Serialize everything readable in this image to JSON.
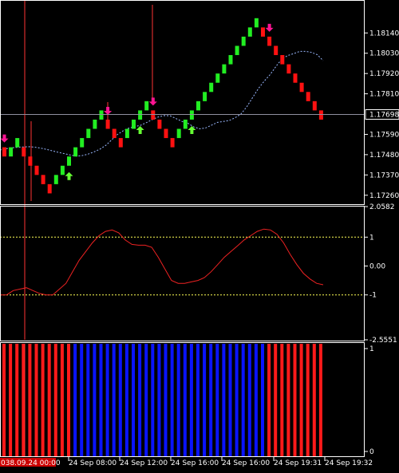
{
  "colors": {
    "background": "#000000",
    "bull_candle": "#22ee22",
    "bear_candle": "#ff1111",
    "ma_line": "#9ab8ff",
    "osc_line": "#ee2222",
    "level_line": "#ffff55",
    "hist_bear": "#ff1a1a",
    "hist_bull": "#0a14ff",
    "buy_arrow": "#66ff33",
    "sell_arrow": "#ff1493",
    "frame": "#ffffff",
    "marker_line": "#ff3333",
    "price_line": "#9090a0"
  },
  "chart_data": [
    {
      "type": "candlestick",
      "title": "",
      "ylim": [
        1.1722,
        1.1831
      ],
      "y_ticks": [
        "1.18140",
        "1.18030",
        "1.17920",
        "1.17810",
        "1.17590",
        "1.17480",
        "1.17370",
        "1.17260"
      ],
      "current_price": "1.17698",
      "bricks": [
        {
          "d": "bear",
          "lo": 1.1747,
          "hi": 1.1752
        },
        {
          "d": "bull",
          "lo": 1.1747,
          "hi": 1.1752
        },
        {
          "d": "bull",
          "lo": 1.1752,
          "hi": 1.1757
        },
        {
          "d": "bear",
          "lo": 1.1747,
          "hi": 1.1752
        },
        {
          "d": "bear",
          "lo": 1.1742,
          "hi": 1.1747
        },
        {
          "d": "bear",
          "lo": 1.1737,
          "hi": 1.1742
        },
        {
          "d": "bear",
          "lo": 1.1732,
          "hi": 1.1737
        },
        {
          "d": "bear",
          "lo": 1.1727,
          "hi": 1.1732
        },
        {
          "d": "bull",
          "lo": 1.1732,
          "hi": 1.1737
        },
        {
          "d": "bull",
          "lo": 1.1737,
          "hi": 1.1742
        },
        {
          "d": "bull",
          "lo": 1.1742,
          "hi": 1.1747
        },
        {
          "d": "bull",
          "lo": 1.1747,
          "hi": 1.1752
        },
        {
          "d": "bull",
          "lo": 1.1752,
          "hi": 1.1757
        },
        {
          "d": "bull",
          "lo": 1.1757,
          "hi": 1.1762
        },
        {
          "d": "bull",
          "lo": 1.1762,
          "hi": 1.1767
        },
        {
          "d": "bull",
          "lo": 1.1767,
          "hi": 1.1772
        },
        {
          "d": "bear",
          "lo": 1.1762,
          "hi": 1.1767
        },
        {
          "d": "bear",
          "lo": 1.1757,
          "hi": 1.1762
        },
        {
          "d": "bear",
          "lo": 1.1752,
          "hi": 1.1757
        },
        {
          "d": "bull",
          "lo": 1.1757,
          "hi": 1.1762
        },
        {
          "d": "bull",
          "lo": 1.1762,
          "hi": 1.1767
        },
        {
          "d": "bull",
          "lo": 1.1767,
          "hi": 1.1772
        },
        {
          "d": "bull",
          "lo": 1.1772,
          "hi": 1.1777
        },
        {
          "d": "bear",
          "lo": 1.1767,
          "hi": 1.1772
        },
        {
          "d": "bear",
          "lo": 1.1762,
          "hi": 1.1767
        },
        {
          "d": "bear",
          "lo": 1.1757,
          "hi": 1.1762
        },
        {
          "d": "bear",
          "lo": 1.1752,
          "hi": 1.1757
        },
        {
          "d": "bull",
          "lo": 1.1757,
          "hi": 1.1762
        },
        {
          "d": "bull",
          "lo": 1.1762,
          "hi": 1.1767
        },
        {
          "d": "bull",
          "lo": 1.1767,
          "hi": 1.1772
        },
        {
          "d": "bull",
          "lo": 1.1772,
          "hi": 1.1777
        },
        {
          "d": "bull",
          "lo": 1.1777,
          "hi": 1.1782
        },
        {
          "d": "bull",
          "lo": 1.1782,
          "hi": 1.1787
        },
        {
          "d": "bull",
          "lo": 1.1787,
          "hi": 1.1792
        },
        {
          "d": "bull",
          "lo": 1.1792,
          "hi": 1.1797
        },
        {
          "d": "bull",
          "lo": 1.1797,
          "hi": 1.1802
        },
        {
          "d": "bull",
          "lo": 1.1802,
          "hi": 1.1807
        },
        {
          "d": "bull",
          "lo": 1.1807,
          "hi": 1.1812
        },
        {
          "d": "bull",
          "lo": 1.1812,
          "hi": 1.1817
        },
        {
          "d": "bull",
          "lo": 1.1817,
          "hi": 1.1822
        },
        {
          "d": "bear",
          "lo": 1.1812,
          "hi": 1.1817
        },
        {
          "d": "bear",
          "lo": 1.1807,
          "hi": 1.1812
        },
        {
          "d": "bear",
          "lo": 1.1802,
          "hi": 1.1807
        },
        {
          "d": "bear",
          "lo": 1.1797,
          "hi": 1.1802
        },
        {
          "d": "bear",
          "lo": 1.1792,
          "hi": 1.1797
        },
        {
          "d": "bear",
          "lo": 1.1787,
          "hi": 1.1792
        },
        {
          "d": "bear",
          "lo": 1.1782,
          "hi": 1.1787
        },
        {
          "d": "bear",
          "lo": 1.1777,
          "hi": 1.1782
        },
        {
          "d": "bear",
          "lo": 1.1772,
          "hi": 1.1777
        },
        {
          "d": "bear",
          "lo": 1.1767,
          "hi": 1.1772
        }
      ],
      "moving_average": [
        1.17505,
        1.17512,
        1.17517,
        1.1752,
        1.17522,
        1.17523,
        1.1752,
        1.17515,
        1.17508,
        1.175,
        1.17492,
        1.17485,
        1.17478,
        1.17472,
        1.17475,
        1.17483,
        1.17495,
        1.1751,
        1.1753,
        1.1756,
        1.1759,
        1.1761,
        1.17625,
        1.17632,
        1.1764,
        1.17655,
        1.17672,
        1.17685,
        1.17692,
        1.1769,
        1.17675,
        1.1766,
        1.1765,
        1.1763,
        1.1762,
        1.17625,
        1.1764,
        1.17655,
        1.1766,
        1.17665,
        1.1768,
        1.177,
        1.1774,
        1.1779,
        1.1784,
        1.1788,
        1.17915,
        1.1796,
        1.18,
        1.18018,
        1.18028,
        1.1804,
        1.1804,
        1.18035,
        1.18022,
        1.1799
      ],
      "buy_signals": [
        10,
        21,
        29
      ],
      "sell_signals": [
        0,
        16,
        23,
        41
      ]
    },
    {
      "type": "line",
      "title": "",
      "ylim": [
        -2.5551,
        2.0582
      ],
      "y_ticks": [
        "2.0582",
        "1",
        "0.00",
        "-1",
        "-2.5551"
      ],
      "levels": [
        1,
        -1
      ],
      "values": [
        -1.0,
        -1.0,
        -0.85,
        -0.8,
        -0.75,
        -0.85,
        -0.95,
        -1.0,
        -1.0,
        -0.8,
        -0.6,
        -0.2,
        0.2,
        0.5,
        0.8,
        1.05,
        1.2,
        1.25,
        1.15,
        0.9,
        0.75,
        0.72,
        0.72,
        0.65,
        0.3,
        -0.1,
        -0.5,
        -0.6,
        -0.6,
        -0.55,
        -0.5,
        -0.4,
        -0.2,
        0.05,
        0.3,
        0.5,
        0.7,
        0.9,
        1.05,
        1.2,
        1.28,
        1.25,
        1.1,
        0.8,
        0.4,
        0.05,
        -0.25,
        -0.45,
        -0.6,
        -0.65
      ]
    },
    {
      "type": "bar",
      "title": "",
      "ylim": [
        0,
        1
      ],
      "y_ticks": [
        "1",
        "0"
      ],
      "values_by_brick": [
        "bear",
        "bear",
        "bear",
        "bear",
        "bear",
        "bear",
        "bear",
        "bear",
        "bear",
        "bear",
        "bear",
        "bull",
        "bull",
        "bull",
        "bull",
        "bull",
        "bull",
        "bull",
        "bull",
        "bull",
        "bull",
        "bull",
        "bull",
        "bull",
        "bull",
        "bull",
        "bull",
        "bull",
        "bull",
        "bull",
        "bull",
        "bull",
        "bull",
        "bull",
        "bull",
        "bull",
        "bull",
        "bull",
        "bull",
        "bull",
        "bull",
        "bear",
        "bear",
        "bear",
        "bear",
        "bear",
        "bear",
        "bear",
        "bear",
        "bear"
      ]
    }
  ],
  "time_axis": {
    "labels": [
      "24 Sep 08:00",
      "24 Sep 12:00",
      "24 Sep 16:00",
      "24 Sep 16:00",
      "24 Sep 19:31",
      "24 Sep 19:32"
    ],
    "highlighted_label": "038.09.24 00:00"
  }
}
